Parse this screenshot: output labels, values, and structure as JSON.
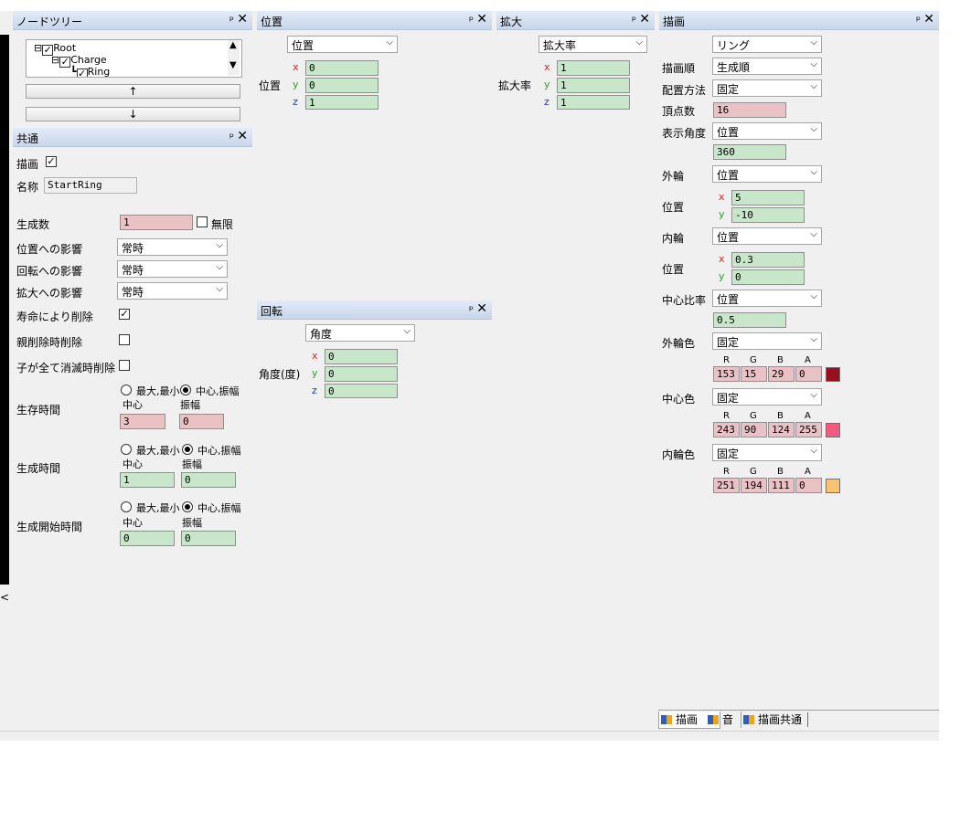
{
  "colors": {
    "accent_title": "#c9d7ea",
    "green_input": "#c8e6c9",
    "pink_input": "#eac2c6"
  },
  "nodetree": {
    "title": "ノードツリー",
    "items": [
      {
        "label": "Root"
      },
      {
        "label": "Charge"
      },
      {
        "label": "Ring"
      }
    ],
    "up": "↑",
    "down": "↓"
  },
  "common": {
    "title": "共通",
    "draw_label": "描画",
    "draw_checked": "✓",
    "name_label": "名称",
    "name_value": "StartRing",
    "gen_count_label": "生成数",
    "gen_count_value": "1",
    "infinite_label": "無限",
    "pos_influence_label": "位置への影響",
    "pos_influence_value": "常時",
    "rot_influence_label": "回転への影響",
    "rot_influence_value": "常時",
    "scale_influence_label": "拡大への影響",
    "scale_influence_value": "常時",
    "life_delete_label": "寿命により削除",
    "life_delete_checked": "✓",
    "parent_delete_label": "親削除時削除",
    "child_delete_label": "子が全て消滅時削除",
    "radio_minmax": "最大,最小",
    "radio_centeramp": "中心,振幅",
    "center": "中心",
    "amplitude": "振幅",
    "lifetime_label": "生存時間",
    "lifetime_center": "3",
    "lifetime_amp": "0",
    "gentime_label": "生成時間",
    "gentime_center": "1",
    "gentime_amp": "0",
    "genstart_label": "生成開始時間",
    "genstart_center": "0",
    "genstart_amp": "0"
  },
  "position": {
    "title": "位置",
    "mode": "位置",
    "label": "位置",
    "x": "0",
    "y": "0",
    "z": "1"
  },
  "scale": {
    "title": "拡大",
    "mode": "拡大率",
    "label": "拡大率",
    "x": "1",
    "y": "1",
    "z": "1"
  },
  "rotation": {
    "title": "回転",
    "mode": "角度",
    "label": "角度(度)",
    "x": "0",
    "y": "0",
    "z": "0"
  },
  "axes": {
    "x": "x",
    "y": "y",
    "z": "z"
  },
  "render": {
    "title": "描画",
    "type": "リング",
    "order_label": "描画順",
    "order_value": "生成順",
    "placement_label": "配置方法",
    "placement_value": "固定",
    "vertices_label": "頂点数",
    "vertices_value": "16",
    "angle_label": "表示角度",
    "angle_mode": "位置",
    "angle_value": "360",
    "outer_label": "外輪",
    "outer_mode": "位置",
    "outer_pos_label": "位置",
    "outer_x": "5",
    "outer_y": "-10",
    "inner_label": "内輪",
    "inner_mode": "位置",
    "inner_pos_label": "位置",
    "inner_x": "0.3",
    "inner_y": "0",
    "center_ratio_label": "中心比率",
    "center_ratio_mode": "位置",
    "center_ratio_value": "0.5",
    "outer_color_label": "外輪色",
    "outer_color_mode": "固定",
    "outer_color": {
      "r": "153",
      "g": "15",
      "b": "29",
      "a": "0",
      "hex": "#990f1d"
    },
    "center_color_label": "中心色",
    "center_color_mode": "固定",
    "center_color": {
      "r": "243",
      "g": "90",
      "b": "124",
      "a": "255",
      "hex": "#f35a7c"
    },
    "inner_color_label": "内輪色",
    "inner_color_mode": "固定",
    "inner_color": {
      "r": "251",
      "g": "194",
      "b": "111",
      "a": "0",
      "hex": "#fbc26f"
    },
    "rgba": {
      "r": "R",
      "g": "G",
      "b": "B",
      "a": "A"
    }
  },
  "tabs": [
    {
      "label": "描画"
    },
    {
      "label": "音"
    },
    {
      "label": "描画共通"
    }
  ],
  "icons": {
    "pin": "pin-icon",
    "close": "close-icon",
    "dropdown": "chevron-down-icon"
  }
}
